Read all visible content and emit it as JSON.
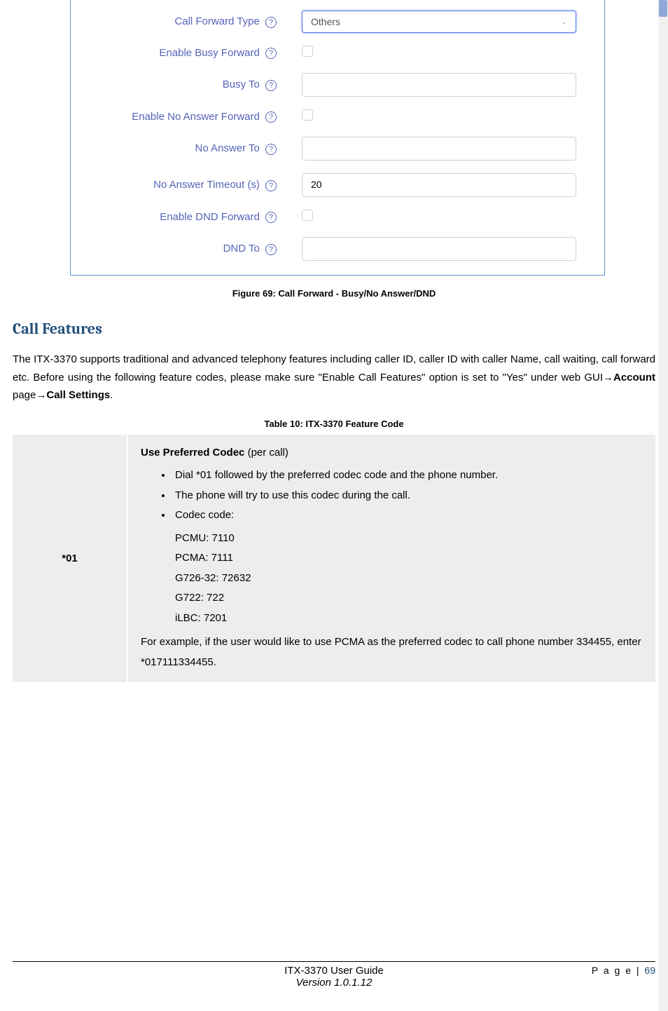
{
  "form": {
    "rows": {
      "call_forward_type": {
        "label": "Call Forward Type",
        "value": "Others"
      },
      "enable_busy_forward": {
        "label": "Enable Busy Forward"
      },
      "busy_to": {
        "label": "Busy To",
        "value": ""
      },
      "enable_no_answer_forward": {
        "label": "Enable No Answer Forward"
      },
      "no_answer_to": {
        "label": "No Answer To",
        "value": ""
      },
      "no_answer_timeout": {
        "label": "No Answer Timeout (s)",
        "value": "20"
      },
      "enable_dnd_forward": {
        "label": "Enable DND Forward"
      },
      "dnd_to": {
        "label": "DND To",
        "value": ""
      }
    }
  },
  "figure_caption": "Figure 69: Call Forward - Busy/No Answer/DND",
  "section_title": "Call Features",
  "body": {
    "p1a": "The ITX-3370 supports traditional and advanced telephony features including caller ID, caller ID with caller Name, call waiting, call forward etc. Before using the following feature codes, please make sure \"Enable Call Features\" option is set to \"Yes\" under web GUI",
    "arrow": "→",
    "accountBold": "Account",
    "pageWord": " page",
    "callSettingsBold": "Call Settings",
    "period": "."
  },
  "table_caption": "Table 10: ITX-3370 Feature Code",
  "table": {
    "code": "*01",
    "title_bold": "Use Preferred Codec",
    "title_rest": " (per call)",
    "bullets": [
      "Dial *01 followed by the preferred codec code and the phone number.",
      "The phone will try to use this codec during the call.",
      "Codec code:"
    ],
    "codecs": [
      "PCMU: 7110",
      "PCMA: 7111",
      "G726-32: 72632",
      "G722: 722",
      "iLBC: 7201"
    ],
    "example": "For example, if the user would like to use PCMA as the preferred codec to call phone number 334455, enter *017111334455."
  },
  "footer": {
    "page_label": "P a g e | ",
    "page_num": "69",
    "title": "ITX-3370 User Guide",
    "version": "Version 1.0.1.12"
  }
}
